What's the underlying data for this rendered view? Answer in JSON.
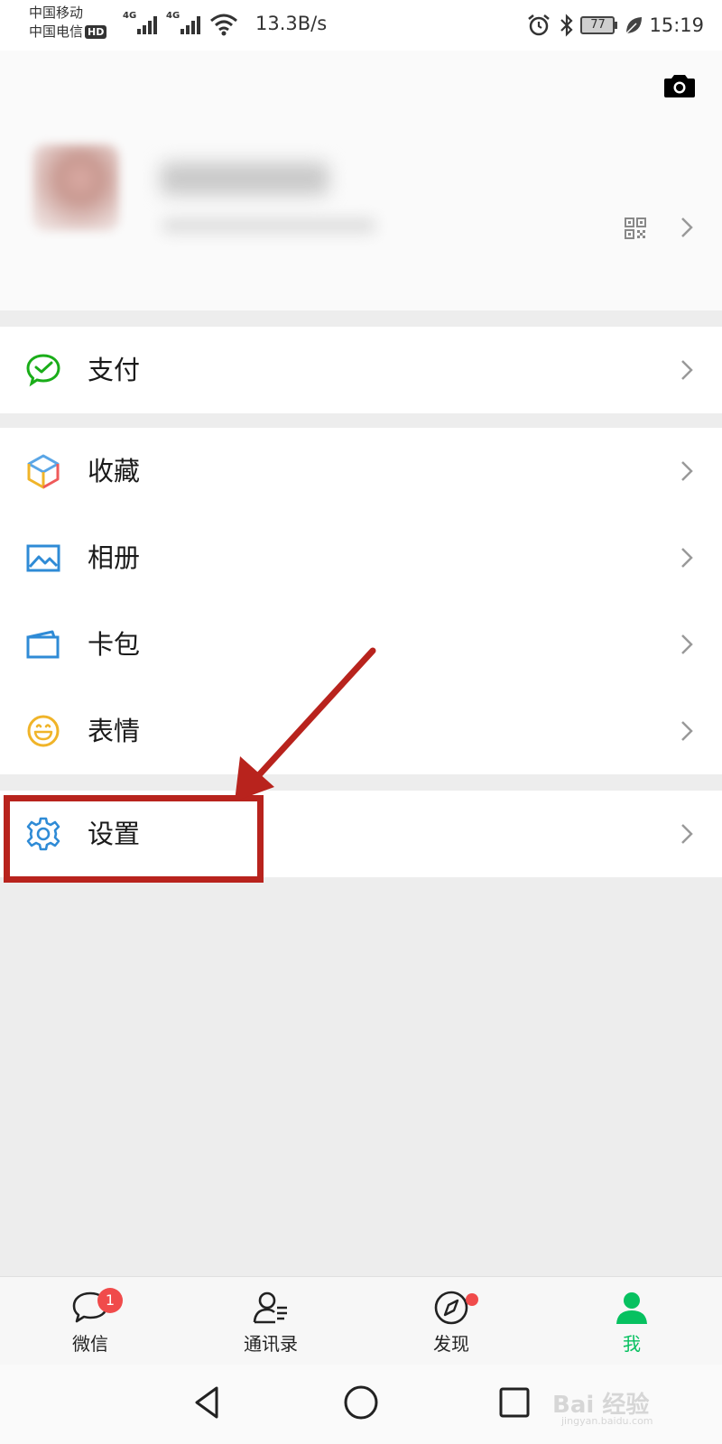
{
  "status_bar": {
    "carrier_1": "中国移动",
    "carrier_2": "中国电信",
    "hd_badge": "HD",
    "network_1": "4G",
    "network_2": "4G",
    "speed": "13.3B/s",
    "battery": "77",
    "time": "15:19"
  },
  "profile": {
    "camera_icon": "camera-icon",
    "qr_icon": "qrcode-icon",
    "chevron_icon": "chevron-right-icon"
  },
  "menu": {
    "pay": {
      "label": "支付",
      "icon": "wechat-pay-icon"
    },
    "favorites": {
      "label": "收藏",
      "icon": "cube-icon"
    },
    "album": {
      "label": "相册",
      "icon": "image-icon"
    },
    "card_wallet": {
      "label": "卡包",
      "icon": "wallet-icon"
    },
    "stickers": {
      "label": "表情",
      "icon": "smiley-icon"
    },
    "settings": {
      "label": "设置",
      "icon": "gear-icon"
    }
  },
  "tabs": [
    {
      "label": "微信",
      "badge": "1",
      "icon": "chat-bubble-icon"
    },
    {
      "label": "通讯录",
      "icon": "contacts-icon"
    },
    {
      "label": "发现",
      "icon": "compass-icon"
    },
    {
      "label": "我",
      "icon": "person-icon"
    }
  ],
  "watermark": {
    "text": "Bai 经验",
    "sub": "jingyan.baidu.com"
  },
  "colors": {
    "accent": "#07c160",
    "highlight": "#b8231d",
    "badge": "#f04b4b"
  }
}
